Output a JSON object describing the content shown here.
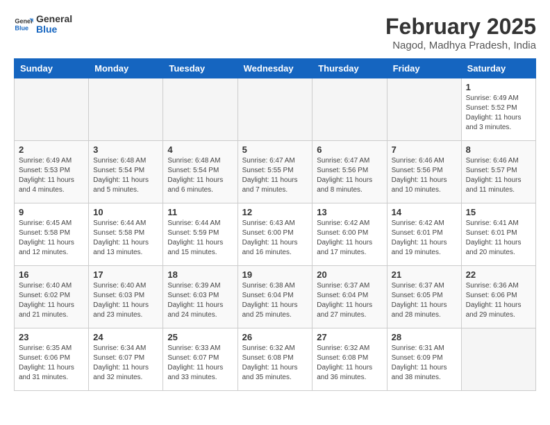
{
  "header": {
    "logo_line1": "General",
    "logo_line2": "Blue",
    "month_title": "February 2025",
    "subtitle": "Nagod, Madhya Pradesh, India"
  },
  "weekdays": [
    "Sunday",
    "Monday",
    "Tuesday",
    "Wednesday",
    "Thursday",
    "Friday",
    "Saturday"
  ],
  "weeks": [
    [
      {
        "day": "",
        "info": ""
      },
      {
        "day": "",
        "info": ""
      },
      {
        "day": "",
        "info": ""
      },
      {
        "day": "",
        "info": ""
      },
      {
        "day": "",
        "info": ""
      },
      {
        "day": "",
        "info": ""
      },
      {
        "day": "1",
        "info": "Sunrise: 6:49 AM\nSunset: 5:52 PM\nDaylight: 11 hours\nand 3 minutes."
      }
    ],
    [
      {
        "day": "2",
        "info": "Sunrise: 6:49 AM\nSunset: 5:53 PM\nDaylight: 11 hours\nand 4 minutes."
      },
      {
        "day": "3",
        "info": "Sunrise: 6:48 AM\nSunset: 5:54 PM\nDaylight: 11 hours\nand 5 minutes."
      },
      {
        "day": "4",
        "info": "Sunrise: 6:48 AM\nSunset: 5:54 PM\nDaylight: 11 hours\nand 6 minutes."
      },
      {
        "day": "5",
        "info": "Sunrise: 6:47 AM\nSunset: 5:55 PM\nDaylight: 11 hours\nand 7 minutes."
      },
      {
        "day": "6",
        "info": "Sunrise: 6:47 AM\nSunset: 5:56 PM\nDaylight: 11 hours\nand 8 minutes."
      },
      {
        "day": "7",
        "info": "Sunrise: 6:46 AM\nSunset: 5:56 PM\nDaylight: 11 hours\nand 10 minutes."
      },
      {
        "day": "8",
        "info": "Sunrise: 6:46 AM\nSunset: 5:57 PM\nDaylight: 11 hours\nand 11 minutes."
      }
    ],
    [
      {
        "day": "9",
        "info": "Sunrise: 6:45 AM\nSunset: 5:58 PM\nDaylight: 11 hours\nand 12 minutes."
      },
      {
        "day": "10",
        "info": "Sunrise: 6:44 AM\nSunset: 5:58 PM\nDaylight: 11 hours\nand 13 minutes."
      },
      {
        "day": "11",
        "info": "Sunrise: 6:44 AM\nSunset: 5:59 PM\nDaylight: 11 hours\nand 15 minutes."
      },
      {
        "day": "12",
        "info": "Sunrise: 6:43 AM\nSunset: 6:00 PM\nDaylight: 11 hours\nand 16 minutes."
      },
      {
        "day": "13",
        "info": "Sunrise: 6:42 AM\nSunset: 6:00 PM\nDaylight: 11 hours\nand 17 minutes."
      },
      {
        "day": "14",
        "info": "Sunrise: 6:42 AM\nSunset: 6:01 PM\nDaylight: 11 hours\nand 19 minutes."
      },
      {
        "day": "15",
        "info": "Sunrise: 6:41 AM\nSunset: 6:01 PM\nDaylight: 11 hours\nand 20 minutes."
      }
    ],
    [
      {
        "day": "16",
        "info": "Sunrise: 6:40 AM\nSunset: 6:02 PM\nDaylight: 11 hours\nand 21 minutes."
      },
      {
        "day": "17",
        "info": "Sunrise: 6:40 AM\nSunset: 6:03 PM\nDaylight: 11 hours\nand 23 minutes."
      },
      {
        "day": "18",
        "info": "Sunrise: 6:39 AM\nSunset: 6:03 PM\nDaylight: 11 hours\nand 24 minutes."
      },
      {
        "day": "19",
        "info": "Sunrise: 6:38 AM\nSunset: 6:04 PM\nDaylight: 11 hours\nand 25 minutes."
      },
      {
        "day": "20",
        "info": "Sunrise: 6:37 AM\nSunset: 6:04 PM\nDaylight: 11 hours\nand 27 minutes."
      },
      {
        "day": "21",
        "info": "Sunrise: 6:37 AM\nSunset: 6:05 PM\nDaylight: 11 hours\nand 28 minutes."
      },
      {
        "day": "22",
        "info": "Sunrise: 6:36 AM\nSunset: 6:06 PM\nDaylight: 11 hours\nand 29 minutes."
      }
    ],
    [
      {
        "day": "23",
        "info": "Sunrise: 6:35 AM\nSunset: 6:06 PM\nDaylight: 11 hours\nand 31 minutes."
      },
      {
        "day": "24",
        "info": "Sunrise: 6:34 AM\nSunset: 6:07 PM\nDaylight: 11 hours\nand 32 minutes."
      },
      {
        "day": "25",
        "info": "Sunrise: 6:33 AM\nSunset: 6:07 PM\nDaylight: 11 hours\nand 33 minutes."
      },
      {
        "day": "26",
        "info": "Sunrise: 6:32 AM\nSunset: 6:08 PM\nDaylight: 11 hours\nand 35 minutes."
      },
      {
        "day": "27",
        "info": "Sunrise: 6:32 AM\nSunset: 6:08 PM\nDaylight: 11 hours\nand 36 minutes."
      },
      {
        "day": "28",
        "info": "Sunrise: 6:31 AM\nSunset: 6:09 PM\nDaylight: 11 hours\nand 38 minutes."
      },
      {
        "day": "",
        "info": ""
      }
    ]
  ]
}
